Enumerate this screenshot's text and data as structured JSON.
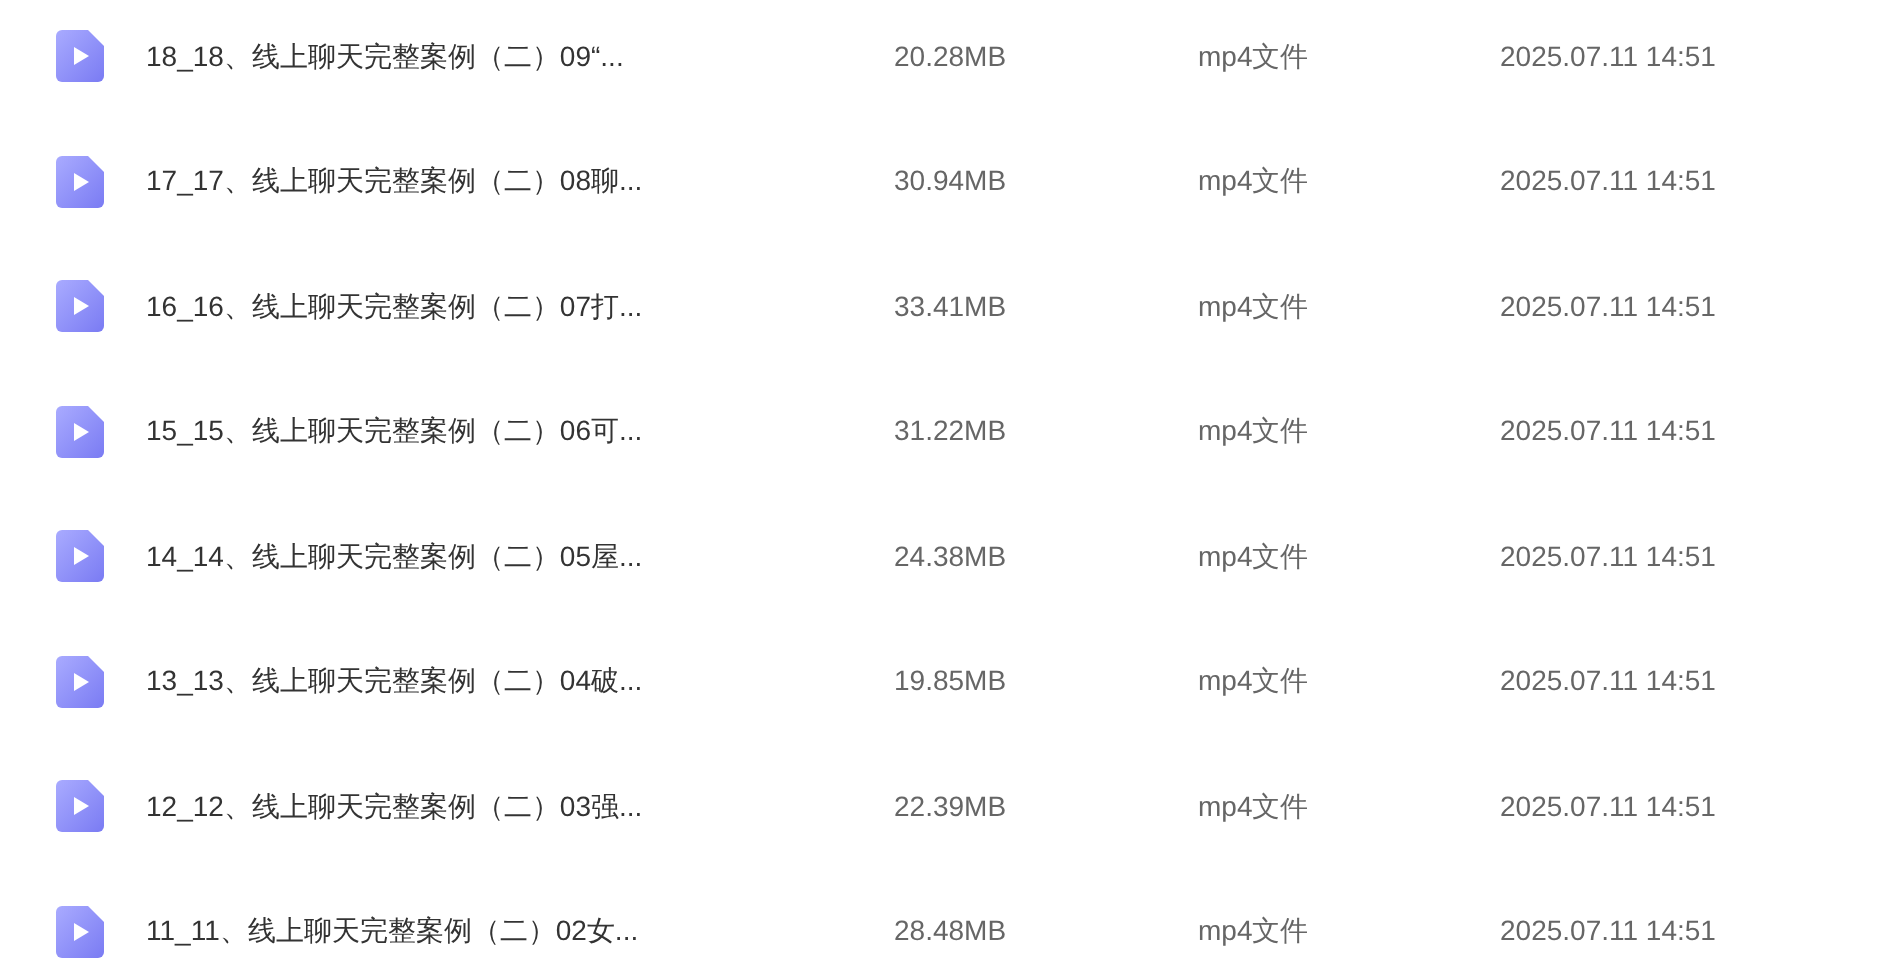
{
  "files": [
    {
      "name": "18_18、线上聊天完整案例（二）09“...",
      "size": "20.28MB",
      "type": "mp4文件",
      "modified": "2025.07.11 14:51"
    },
    {
      "name": "17_17、线上聊天完整案例（二）08聊...",
      "size": "30.94MB",
      "type": "mp4文件",
      "modified": "2025.07.11 14:51"
    },
    {
      "name": "16_16、线上聊天完整案例（二）07打...",
      "size": "33.41MB",
      "type": "mp4文件",
      "modified": "2025.07.11 14:51"
    },
    {
      "name": "15_15、线上聊天完整案例（二）06可...",
      "size": "31.22MB",
      "type": "mp4文件",
      "modified": "2025.07.11 14:51"
    },
    {
      "name": "14_14、线上聊天完整案例（二）05屋...",
      "size": "24.38MB",
      "type": "mp4文件",
      "modified": "2025.07.11 14:51"
    },
    {
      "name": "13_13、线上聊天完整案例（二）04破...",
      "size": "19.85MB",
      "type": "mp4文件",
      "modified": "2025.07.11 14:51"
    },
    {
      "name": "12_12、线上聊天完整案例（二）03强...",
      "size": "22.39MB",
      "type": "mp4文件",
      "modified": "2025.07.11 14:51"
    },
    {
      "name": "11_11、线上聊天完整案例（二）02女...",
      "size": "28.48MB",
      "type": "mp4文件",
      "modified": "2025.07.11 14:51"
    }
  ]
}
